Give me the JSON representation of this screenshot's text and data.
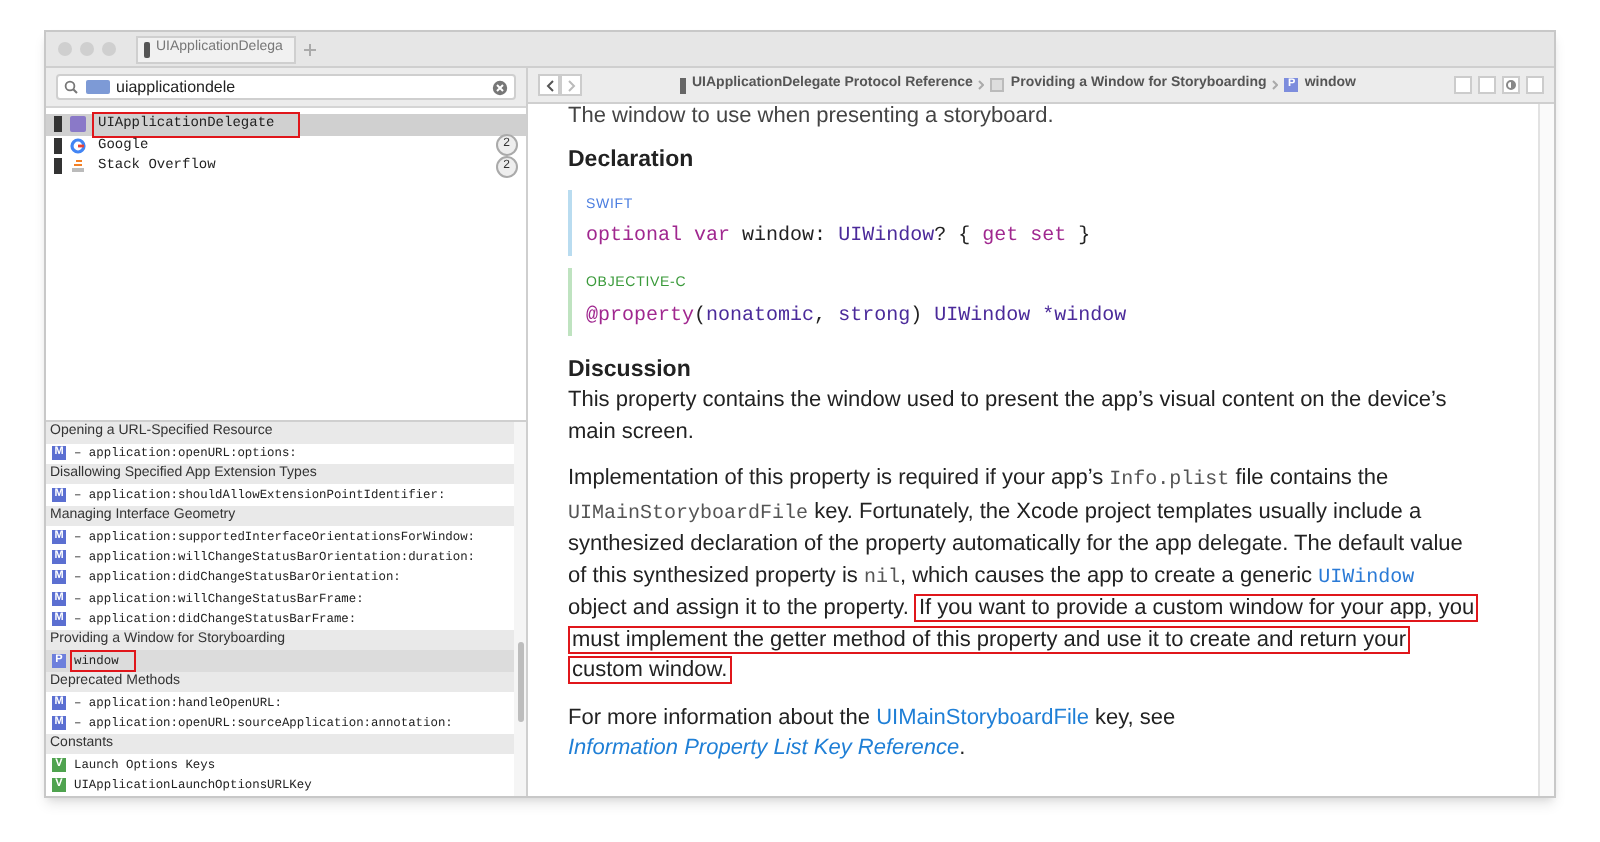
{
  "tab": {
    "title": "UIApplicationDelega"
  },
  "search": {
    "value": "uiapplicationdele"
  },
  "results": [
    {
      "title": "UIApplicationDelegate",
      "kind": "protocol",
      "selected": true,
      "annotated": true
    },
    {
      "title": "Google",
      "kind": "google",
      "count": "2",
      "selected": false,
      "annotated": false
    },
    {
      "title": "Stack Overflow",
      "kind": "stack",
      "count": "2",
      "selected": false,
      "annotated": false
    }
  ],
  "outline": [
    {
      "header": "Opening a URL-Specified Resource",
      "items": [
        {
          "kind": "method",
          "badge": "M",
          "text": "– application:openURL:options:",
          "selected": false,
          "annotated": false
        }
      ]
    },
    {
      "header": "Disallowing Specified App Extension Types",
      "items": [
        {
          "kind": "method",
          "badge": "M",
          "text": "– application:shouldAllowExtensionPointIdentifier:",
          "selected": false,
          "annotated": false
        }
      ]
    },
    {
      "header": "Managing Interface Geometry",
      "items": [
        {
          "kind": "method",
          "badge": "M",
          "text": "– application:supportedInterfaceOrientationsForWindow:",
          "selected": false,
          "annotated": false
        },
        {
          "kind": "method",
          "badge": "M",
          "text": "– application:willChangeStatusBarOrientation:duration:",
          "selected": false,
          "annotated": false
        },
        {
          "kind": "method",
          "badge": "M",
          "text": "– application:didChangeStatusBarOrientation:",
          "selected": false,
          "annotated": false
        },
        {
          "kind": "method",
          "badge": "M",
          "text": "– application:willChangeStatusBarFrame:",
          "selected": false,
          "annotated": false
        },
        {
          "kind": "method",
          "badge": "M",
          "text": "– application:didChangeStatusBarFrame:",
          "selected": false,
          "annotated": false
        }
      ]
    },
    {
      "header": "Providing a Window for Storyboarding",
      "items": [
        {
          "kind": "property",
          "badge": "P",
          "text": "window",
          "selected": true,
          "annotated": true
        }
      ]
    },
    {
      "header": "Deprecated Methods",
      "items": [
        {
          "kind": "method",
          "badge": "M",
          "text": "– application:handleOpenURL:",
          "selected": false,
          "annotated": false
        },
        {
          "kind": "method",
          "badge": "M",
          "text": "– application:openURL:sourceApplication:annotation:",
          "selected": false,
          "annotated": false
        }
      ]
    },
    {
      "header": "Constants",
      "items": [
        {
          "kind": "constant",
          "badge": "V",
          "text": "Launch Options Keys",
          "selected": false,
          "annotated": false
        },
        {
          "kind": "constant",
          "badge": "V",
          "text": "UIApplicationLaunchOptionsURLKey",
          "selected": false,
          "annotated": false
        }
      ]
    }
  ],
  "breadcrumb": [
    {
      "kind": "book",
      "text": "UIApplicationDelegate Protocol Reference"
    },
    {
      "kind": "doc",
      "text": "Providing a Window for Storyboarding"
    },
    {
      "kind": "property",
      "badge": "P",
      "text": "window"
    }
  ],
  "content": {
    "cut_line": "The window to use when presenting a storyboard.",
    "declaration_heading": "Declaration",
    "code_blocks": [
      {
        "kind": "swift",
        "language": "SWIFT",
        "tokens": [
          {
            "kind": "kw",
            "text": "optional var"
          },
          {
            "kind": "plain",
            "text": "window:"
          },
          {
            "kind": "type",
            "text": "UIWindow"
          },
          {
            "kind": "plain",
            "text": "? {"
          },
          {
            "kind": "kw",
            "text": "get set"
          },
          {
            "kind": "plain",
            "text": "}"
          }
        ]
      },
      {
        "kind": "objc",
        "language": "OBJECTIVE-C",
        "tokens": [
          {
            "kind": "kw",
            "text": "@property"
          },
          {
            "kind": "plain",
            "text": "("
          },
          {
            "kind": "type",
            "text": "nonatomic"
          },
          {
            "kind": "plain",
            "text": ","
          },
          {
            "kind": "type",
            "text": "strong"
          },
          {
            "kind": "plain",
            "text": ")"
          },
          {
            "kind": "type",
            "text": "UIWindow *window"
          }
        ]
      }
    ],
    "discussion_heading": "Discussion",
    "paragraphs": [
      [
        {
          "kind": "text",
          "text": "This property contains the window used to present the app’s visual content on the device’s main screen."
        }
      ],
      [
        {
          "kind": "text",
          "text": "Implementation of this property is required if your app’s "
        },
        {
          "kind": "code",
          "text": "Info.plist"
        },
        {
          "kind": "text",
          "text": " file contains the "
        },
        {
          "kind": "code",
          "text": "UIMainStoryboardFile"
        },
        {
          "kind": "text",
          "text": " key. Fortunately, the Xcode project templates usually include a synthesized declaration of the property automatically for the app delegate. The default value of this synthesized property is "
        },
        {
          "kind": "code",
          "text": "nil"
        },
        {
          "kind": "text",
          "text": ", which causes the app to create a generic "
        },
        {
          "kind": "codelink",
          "text": "UIWindow"
        },
        {
          "kind": "text",
          "text": " object and assign it to the property. "
        },
        {
          "kind": "annotated",
          "text": "If you want to provide a custom window for your app, you must implement the getter method of this property and use it to create and return your custom window."
        }
      ],
      [
        {
          "kind": "text",
          "text": "For more information about the "
        },
        {
          "kind": "link",
          "text": "UIMainStoryboardFile"
        },
        {
          "kind": "text",
          "text": " key, see "
        },
        {
          "kind": "doclink",
          "text": "Information Property List Key Reference"
        },
        {
          "kind": "text",
          "text": "."
        }
      ]
    ]
  }
}
